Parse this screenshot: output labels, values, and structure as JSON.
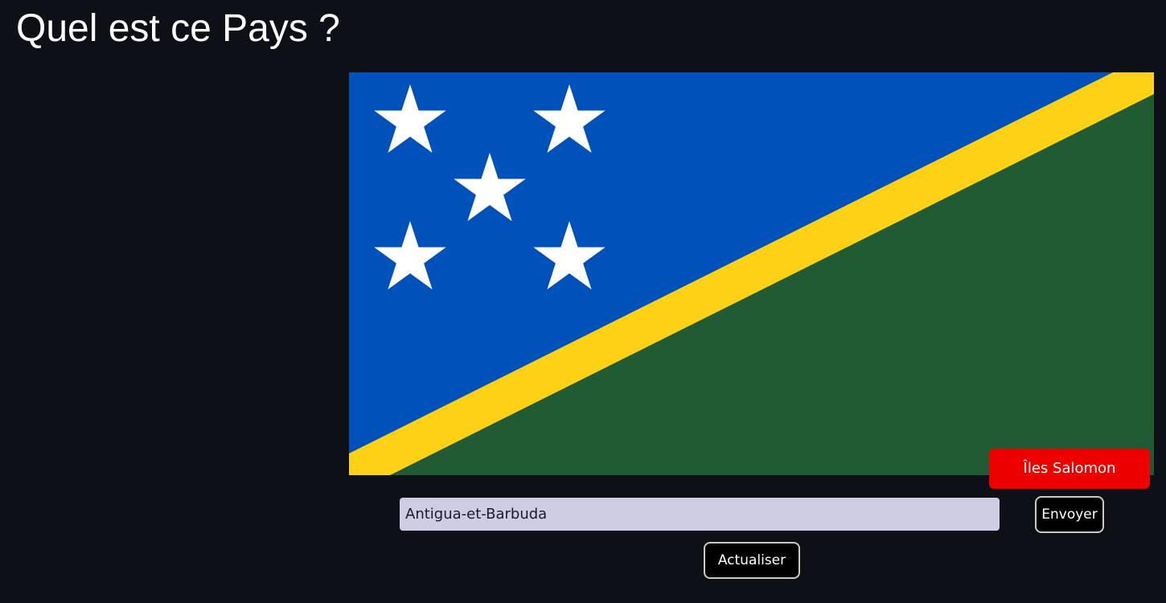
{
  "page": {
    "title": "Quel est ce Pays ?"
  },
  "flag": {
    "country": "Îles Salomon",
    "colors": {
      "blue": "#0051ba",
      "yellow": "#fcd116",
      "green": "#215b33",
      "stars": "#ffffff"
    },
    "star_count": 5
  },
  "answer": {
    "label": "Îles Salomon",
    "color": "#ec0000"
  },
  "form": {
    "input_value": "Antigua-et-Barbuda",
    "input_bg": "#cfcde4",
    "input_text_color": "#1a1a2e",
    "submit_label": "Envoyer",
    "refresh_label": "Actualiser"
  }
}
